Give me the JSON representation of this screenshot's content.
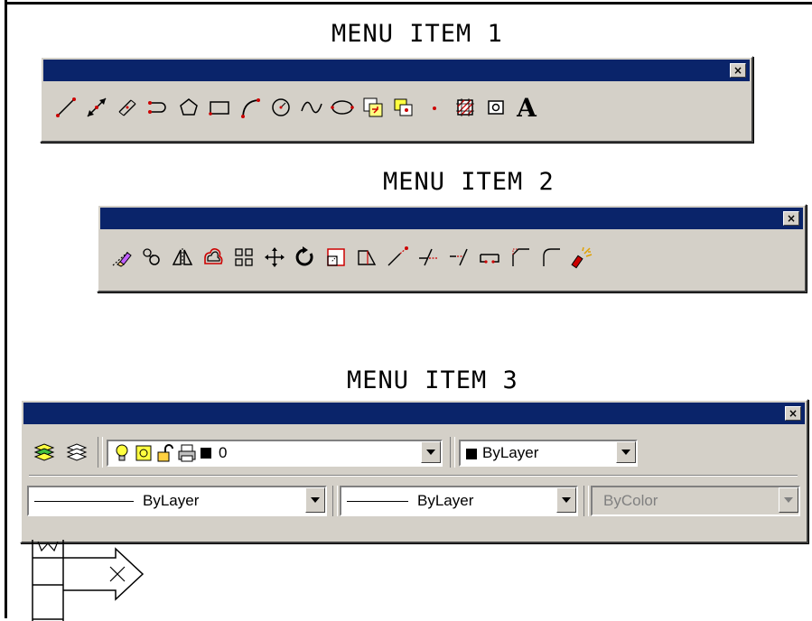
{
  "captions": {
    "menu1": "MENU ITEM 1",
    "menu2": "MENU ITEM 2",
    "menu3": "MENU ITEM 3"
  },
  "toolbar1": {
    "close": "×",
    "icons": [
      "line-icon",
      "construction-line-icon",
      "multiline-icon",
      "polyline-icon",
      "polygon-icon",
      "rectangle-icon",
      "arc-icon",
      "circle-icon",
      "spline-icon",
      "ellipse-icon",
      "insert-block-icon",
      "make-block-icon",
      "point-icon",
      "hatch-icon",
      "region-icon",
      "multiline-text-icon"
    ],
    "text_icon_label": "A"
  },
  "toolbar2": {
    "close": "×",
    "icons": [
      "erase-icon",
      "copy-icon",
      "mirror-icon",
      "offset-icon",
      "array-icon",
      "move-icon",
      "rotate-icon",
      "scale-icon",
      "stretch-icon",
      "lengthen-icon",
      "trim-icon",
      "extend-icon",
      "break-icon",
      "chamfer-icon",
      "fillet-icon",
      "explode-icon"
    ]
  },
  "toolbar3": {
    "close": "×",
    "layer_value": "0",
    "color_value": "ByLayer",
    "linetype_value": "ByLayer",
    "lineweight_value": "ByLayer",
    "plotstyle_value": "ByColor",
    "icons": [
      "layer-properties-icon",
      "make-current-layer-icon",
      "lightbulb-icon",
      "sun-icon",
      "padlock-icon",
      "printer-icon"
    ]
  }
}
